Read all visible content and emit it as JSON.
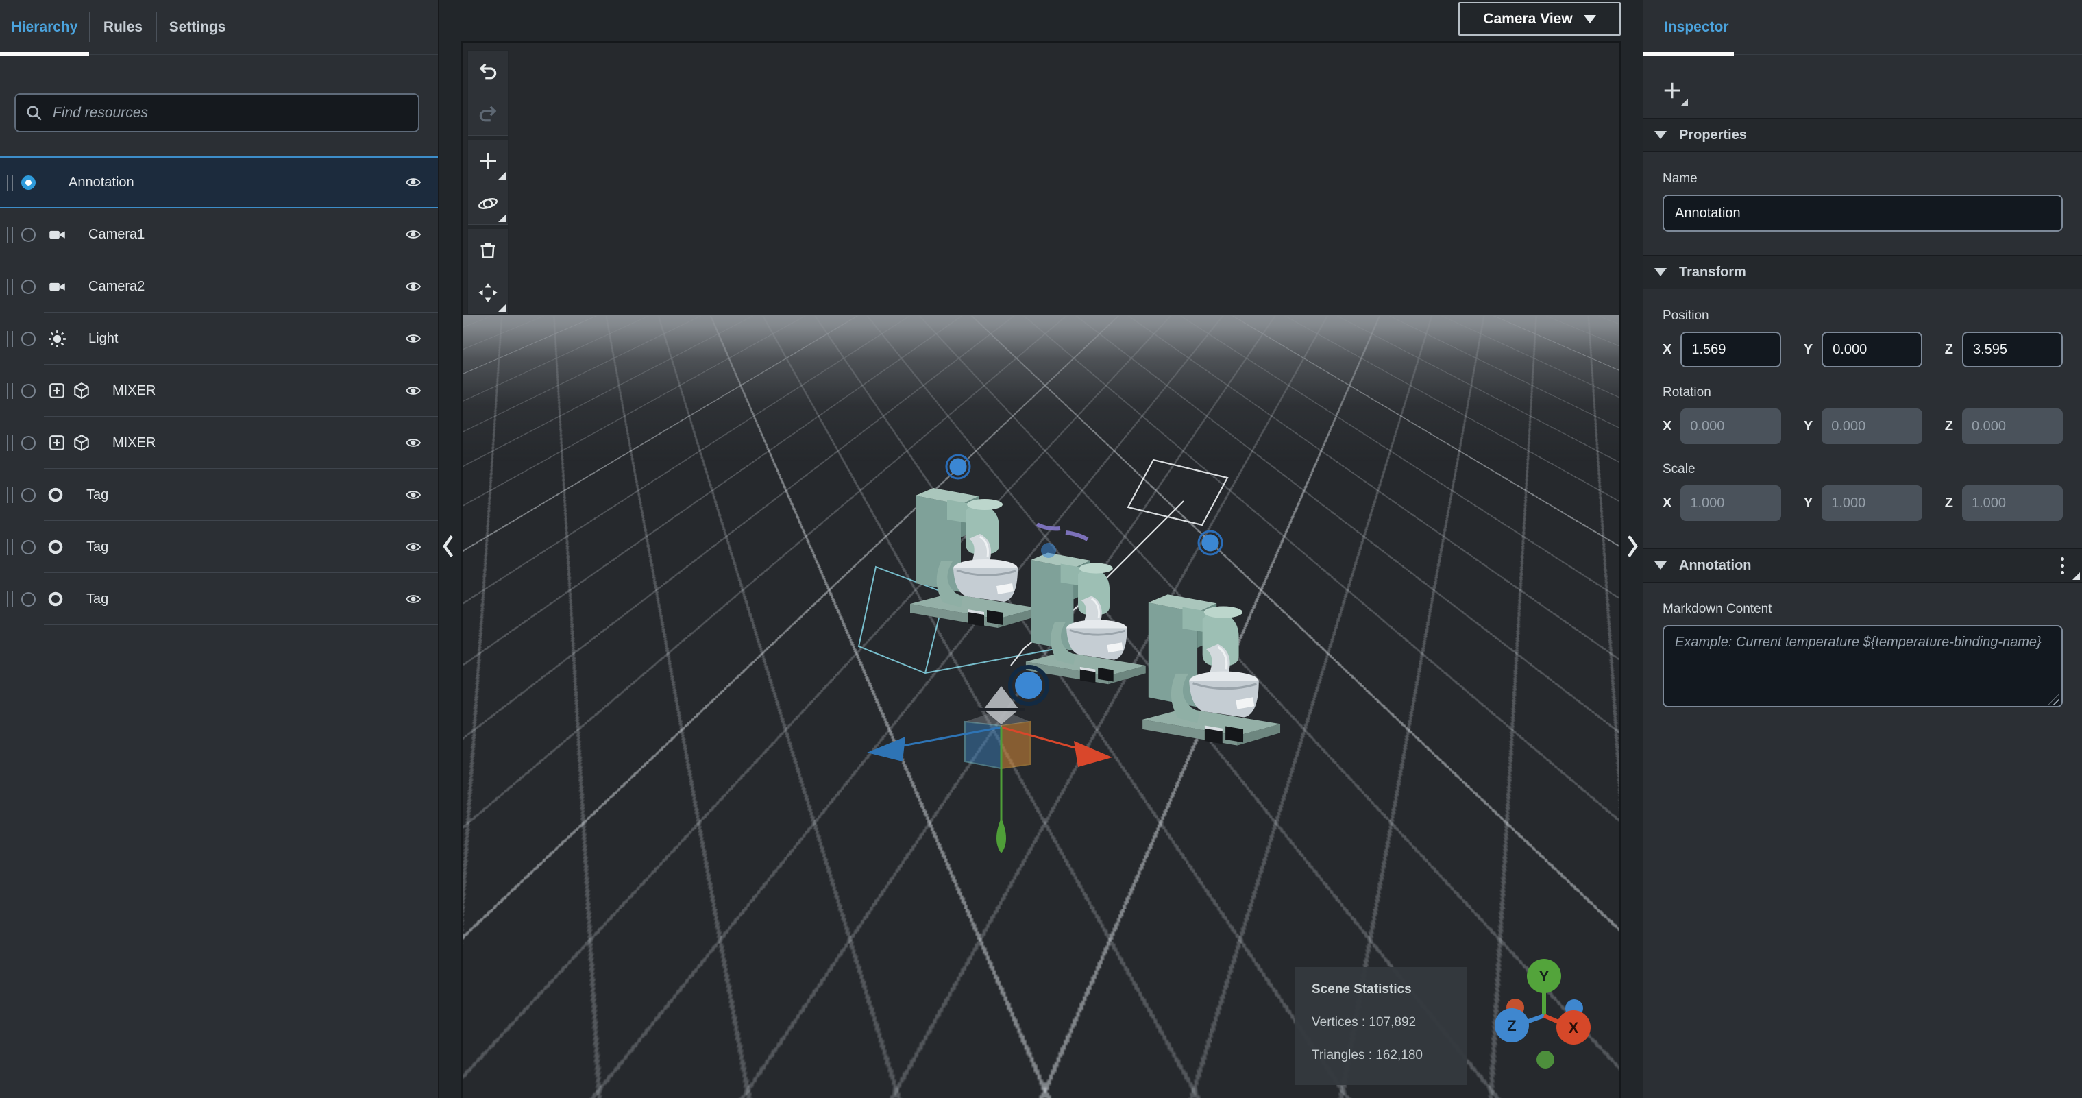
{
  "left_panel": {
    "tabs": [
      {
        "label": "Hierarchy",
        "active": true
      },
      {
        "label": "Rules",
        "active": false
      },
      {
        "label": "Settings",
        "active": false
      }
    ],
    "search": {
      "placeholder": "Find resources"
    },
    "tree": [
      {
        "label": "Annotation",
        "type": "annotation",
        "selected": true
      },
      {
        "label": "Camera1",
        "type": "camera"
      },
      {
        "label": "Camera2",
        "type": "camera"
      },
      {
        "label": "Light",
        "type": "light"
      },
      {
        "label": "MIXER",
        "type": "model"
      },
      {
        "label": "MIXER",
        "type": "model"
      },
      {
        "label": "Tag",
        "type": "tag"
      },
      {
        "label": "Tag",
        "type": "tag"
      },
      {
        "label": "Tag",
        "type": "tag"
      }
    ]
  },
  "viewport": {
    "camera_view_button": "Camera View",
    "toolbar": {
      "undo": "undo",
      "redo": "redo",
      "add": "add-object",
      "orbit": "rotate-tool",
      "delete": "delete-object",
      "move": "translate-tool"
    },
    "scene_statistics": {
      "title": "Scene Statistics",
      "vertices": "Vertices : 107,892",
      "triangles": "Triangles : 162,180"
    },
    "axis_gizmo": {
      "x": "X",
      "y": "Y",
      "z": "Z"
    }
  },
  "inspector": {
    "tab": "Inspector",
    "properties": {
      "title": "Properties",
      "name_label": "Name",
      "name_value": "Annotation"
    },
    "transform": {
      "title": "Transform",
      "position": {
        "label": "Position",
        "x": "1.569",
        "y": "0.000",
        "z": "3.595"
      },
      "rotation": {
        "label": "Rotation",
        "x": "0.000",
        "y": "0.000",
        "z": "0.000",
        "disabled": true
      },
      "scale": {
        "label": "Scale",
        "x": "1.000",
        "y": "1.000",
        "z": "1.000",
        "disabled": true
      },
      "axis": {
        "x": "X",
        "y": "Y",
        "z": "Z"
      }
    },
    "annotation": {
      "title": "Annotation",
      "markdown_label": "Markdown Content",
      "markdown_placeholder": "Example: Current temperature ${temperature-binding-name}"
    }
  },
  "colors": {
    "accent_blue": "#4ba3dd",
    "tag_blue": "#3b87d3",
    "axis_x_red": "#d64829",
    "axis_y_green": "#53a43b",
    "axis_z_blue": "#3f87cf",
    "gizmo_orange": "#e69138"
  }
}
